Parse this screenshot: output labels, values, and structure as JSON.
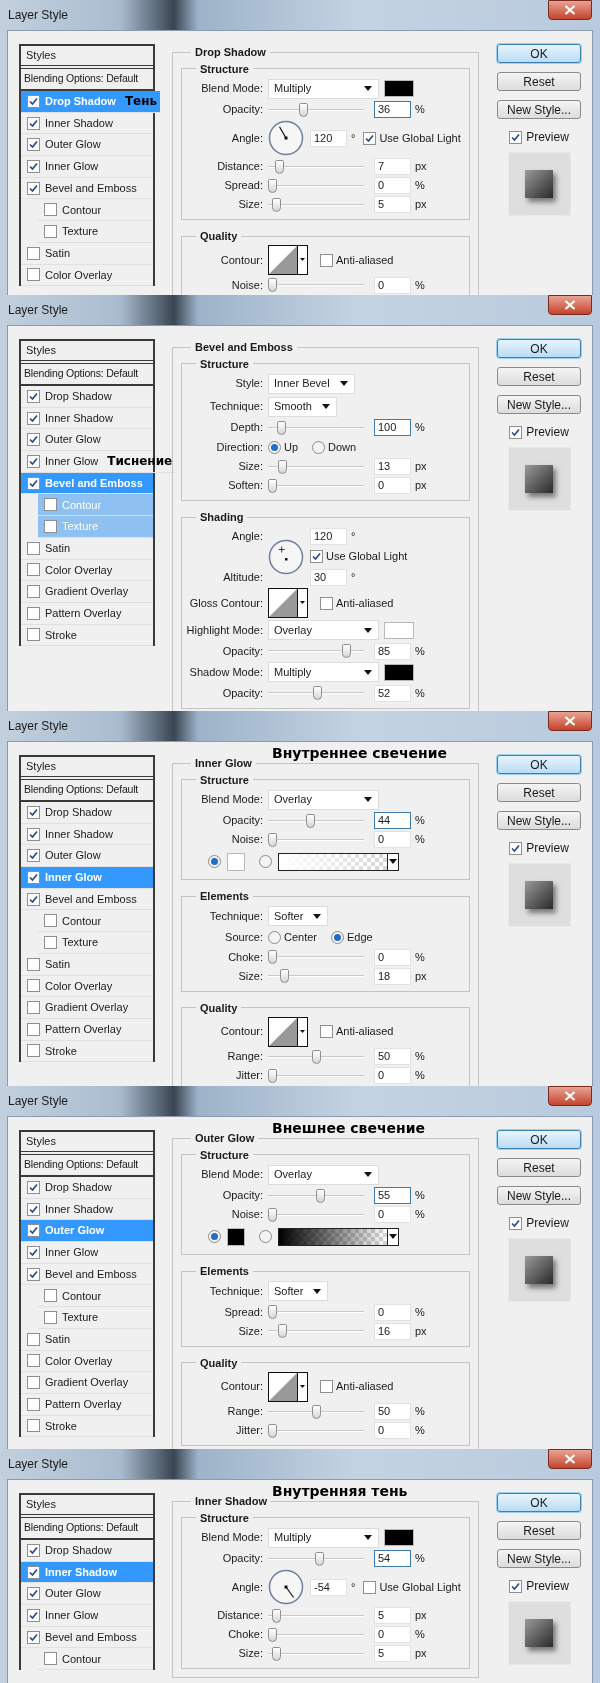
{
  "dialogs": [
    {
      "title": "Layer Style",
      "styles_list": {
        "header": "Styles",
        "blending": {
          "label": "Blending Options: Default",
          "selected": false
        },
        "items": [
          {
            "label": "Drop Shadow",
            "checked": true,
            "selected": true,
            "annotation": "Тень"
          },
          {
            "label": "Inner Shadow",
            "checked": true,
            "selected": false
          },
          {
            "label": "Outer Glow",
            "checked": true,
            "selected": false
          },
          {
            "label": "Inner Glow",
            "checked": true,
            "selected": false
          },
          {
            "label": "Bevel and Emboss",
            "checked": true,
            "selected": false,
            "children": [
              {
                "label": "Contour",
                "checked": false,
                "selected": false
              },
              {
                "label": "Texture",
                "checked": false,
                "selected": false
              }
            ]
          },
          {
            "label": "Satin",
            "checked": false,
            "selected": false
          },
          {
            "label": "Color Overlay",
            "checked": false,
            "selected": false
          }
        ]
      },
      "panel": {
        "title": "Drop Shadow",
        "groups": [
          {
            "title": "Structure",
            "rows": [
              {
                "kind": "mode_dropdown",
                "label": "Blend Mode:",
                "value": "Multiply",
                "color": "#000000"
              },
              {
                "kind": "slider",
                "label": "Opacity:",
                "level": 0.36,
                "value": "36",
                "unit": "%",
                "focused": true
              },
              {
                "kind": "angle",
                "label": "Angle:",
                "value": "120",
                "unit": "°",
                "option": "Use Global Light",
                "checked": true
              },
              {
                "kind": "slider",
                "label": "Distance:",
                "level": 0.08,
                "value": "7",
                "unit": "px",
                "focused": false
              },
              {
                "kind": "slider",
                "label": "Spread:",
                "level": 0,
                "value": "0",
                "unit": "%",
                "focused": false
              },
              {
                "kind": "slider",
                "label": "Size:",
                "level": 0.05,
                "value": "5",
                "unit": "px",
                "focused": false
              }
            ]
          },
          {
            "title": "Quality",
            "rows": [
              {
                "kind": "contour",
                "label": "Contour:",
                "option": "Anti-aliased",
                "checked": false
              },
              {
                "kind": "slider",
                "label": "Noise:",
                "level": 0,
                "value": "0",
                "unit": "%",
                "focused": false
              }
            ]
          }
        ]
      },
      "buttons": [
        "OK",
        "Reset",
        "New Style..."
      ],
      "preview": {
        "label": "Preview",
        "checked": true
      }
    },
    {
      "title": "Layer Style",
      "styles_list": {
        "header": "Styles",
        "blending": {
          "label": "Blending Options: Default",
          "selected": false
        },
        "items": [
          {
            "label": "Drop Shadow",
            "checked": true,
            "selected": false
          },
          {
            "label": "Inner Shadow",
            "checked": true,
            "selected": false
          },
          {
            "label": "Outer Glow",
            "checked": true,
            "selected": false
          },
          {
            "label": "Inner Glow",
            "checked": true,
            "selected": false,
            "annotation": "Тиснение"
          },
          {
            "label": "Bevel and Emboss",
            "checked": true,
            "selected": true,
            "children": [
              {
                "label": "Contour",
                "checked": false,
                "selected": false
              },
              {
                "label": "Texture",
                "checked": false,
                "selected": false
              }
            ]
          },
          {
            "label": "Satin",
            "checked": false,
            "selected": false
          },
          {
            "label": "Color Overlay",
            "checked": false,
            "selected": false
          },
          {
            "label": "Gradient Overlay",
            "checked": false,
            "selected": false
          },
          {
            "label": "Pattern Overlay",
            "checked": false,
            "selected": false
          },
          {
            "label": "Stroke",
            "checked": false,
            "selected": false
          }
        ]
      },
      "panel": {
        "title": "Bevel and Emboss",
        "groups": [
          {
            "title": "Structure",
            "rows": [
              {
                "kind": "dropdown",
                "label": "Style:",
                "value": "Inner Bevel"
              },
              {
                "kind": "dropdown",
                "label": "Technique:",
                "value": "Smooth"
              },
              {
                "kind": "slider",
                "label": "Depth:",
                "level": 0.1,
                "value": "100",
                "unit": "%",
                "focused": true
              },
              {
                "kind": "radio",
                "label": "Direction:",
                "options": [
                  {
                    "label": "Up",
                    "selected": true
                  },
                  {
                    "label": "Down",
                    "selected": false
                  }
                ]
              },
              {
                "kind": "slider",
                "label": "Size:",
                "level": 0.12,
                "value": "13",
                "unit": "px",
                "focused": false
              },
              {
                "kind": "slider",
                "label": "Soften:",
                "level": 0,
                "value": "0",
                "unit": "px",
                "focused": false
              }
            ]
          },
          {
            "title": "Shading",
            "rows": [
              {
                "kind": "shading",
                "label": "Angle:",
                "value": "120",
                "unit": "°",
                "option": "Use Global Light",
                "checked": true,
                "altitude_label": "Altitude:",
                "altitude_value": "30",
                "altitude_unit": "°"
              },
              {
                "kind": "contour",
                "label": "Gloss Contour:",
                "option": "Anti-aliased",
                "checked": false
              },
              {
                "kind": "mode_dropdown",
                "label": "Highlight Mode:",
                "value": "Overlay",
                "color": "#ffffff"
              },
              {
                "kind": "slider",
                "label": "Opacity:",
                "level": 0.85,
                "value": "85",
                "unit": "%",
                "focused": false
              },
              {
                "kind": "mode_dropdown",
                "label": "Shadow Mode:",
                "value": "Multiply",
                "color": "#000000"
              },
              {
                "kind": "slider",
                "label": "Opacity:",
                "level": 0.52,
                "value": "52",
                "unit": "%",
                "focused": false
              }
            ]
          }
        ]
      },
      "buttons": [
        "OK",
        "Reset",
        "New Style..."
      ],
      "preview": {
        "label": "Preview",
        "checked": true
      }
    },
    {
      "title": "Layer Style",
      "styles_list": {
        "header": "Styles",
        "blending": {
          "label": "Blending Options: Default",
          "selected": false
        },
        "items": [
          {
            "label": "Drop Shadow",
            "checked": true,
            "selected": false
          },
          {
            "label": "Inner Shadow",
            "checked": true,
            "selected": false
          },
          {
            "label": "Outer Glow",
            "checked": true,
            "selected": false
          },
          {
            "label": "Inner Glow",
            "checked": true,
            "selected": true
          },
          {
            "label": "Bevel and Emboss",
            "checked": true,
            "selected": false,
            "children": [
              {
                "label": "Contour",
                "checked": false,
                "selected": false
              },
              {
                "label": "Texture",
                "checked": false,
                "selected": false
              }
            ]
          },
          {
            "label": "Satin",
            "checked": false,
            "selected": false
          },
          {
            "label": "Color Overlay",
            "checked": false,
            "selected": false
          },
          {
            "label": "Gradient Overlay",
            "checked": false,
            "selected": false
          },
          {
            "label": "Pattern Overlay",
            "checked": false,
            "selected": false
          },
          {
            "label": "Stroke",
            "checked": false,
            "selected": false
          }
        ]
      },
      "panel": {
        "annotation": "Внутреннее свечение",
        "title": "Inner Glow",
        "groups": [
          {
            "title": "Structure",
            "rows": [
              {
                "kind": "mode_dropdown",
                "label": "Blend Mode:",
                "value": "Overlay"
              },
              {
                "kind": "slider",
                "label": "Opacity:",
                "level": 0.44,
                "value": "44",
                "unit": "%",
                "focused": true
              },
              {
                "kind": "slider",
                "label": "Noise:",
                "level": 0,
                "value": "0",
                "unit": "%",
                "focused": false
              },
              {
                "kind": "fill",
                "choices": [
                  {
                    "kind": "color",
                    "selected": true,
                    "color": "#ffffff"
                  },
                  {
                    "kind": "gradient",
                    "selected": false
                  }
                ]
              }
            ]
          },
          {
            "title": "Elements",
            "rows": [
              {
                "kind": "dropdown",
                "label": "Technique:",
                "value": "Softer"
              },
              {
                "kind": "radio",
                "label": "Source:",
                "options": [
                  {
                    "label": "Center",
                    "selected": false
                  },
                  {
                    "label": "Edge",
                    "selected": true
                  }
                ]
              },
              {
                "kind": "slider",
                "label": "Choke:",
                "level": 0,
                "value": "0",
                "unit": "%",
                "focused": false
              },
              {
                "kind": "slider",
                "label": "Size:",
                "level": 0.14,
                "value": "18",
                "unit": "px",
                "focused": false
              }
            ]
          },
          {
            "title": "Quality",
            "rows": [
              {
                "kind": "contour",
                "label": "Contour:",
                "option": "Anti-aliased",
                "checked": false
              },
              {
                "kind": "slider",
                "label": "Range:",
                "level": 0.5,
                "value": "50",
                "unit": "%",
                "focused": false
              },
              {
                "kind": "slider",
                "label": "Jitter:",
                "level": 0,
                "value": "0",
                "unit": "%",
                "focused": false
              }
            ]
          }
        ]
      },
      "buttons": [
        "OK",
        "Reset",
        "New Style..."
      ],
      "preview": {
        "label": "Preview",
        "checked": true
      }
    },
    {
      "title": "Layer Style",
      "styles_list": {
        "header": "Styles",
        "blending": {
          "label": "Blending Options: Default",
          "selected": false
        },
        "items": [
          {
            "label": "Drop Shadow",
            "checked": true,
            "selected": false
          },
          {
            "label": "Inner Shadow",
            "checked": true,
            "selected": false
          },
          {
            "label": "Outer Glow",
            "checked": true,
            "selected": true
          },
          {
            "label": "Inner Glow",
            "checked": true,
            "selected": false
          },
          {
            "label": "Bevel and Emboss",
            "checked": true,
            "selected": false,
            "children": [
              {
                "label": "Contour",
                "checked": false,
                "selected": false
              },
              {
                "label": "Texture",
                "checked": false,
                "selected": false
              }
            ]
          },
          {
            "label": "Satin",
            "checked": false,
            "selected": false
          },
          {
            "label": "Color Overlay",
            "checked": false,
            "selected": false
          },
          {
            "label": "Gradient Overlay",
            "checked": false,
            "selected": false
          },
          {
            "label": "Pattern Overlay",
            "checked": false,
            "selected": false
          },
          {
            "label": "Stroke",
            "checked": false,
            "selected": false
          }
        ]
      },
      "panel": {
        "annotation": "Внешнее свечение",
        "title": "Outer Glow",
        "groups": [
          {
            "title": "Structure",
            "rows": [
              {
                "kind": "mode_dropdown",
                "label": "Blend Mode:",
                "value": "Overlay"
              },
              {
                "kind": "slider",
                "label": "Opacity:",
                "level": 0.55,
                "value": "55",
                "unit": "%",
                "focused": true
              },
              {
                "kind": "slider",
                "label": "Noise:",
                "level": 0,
                "value": "0",
                "unit": "%",
                "focused": false
              },
              {
                "kind": "fill",
                "choices": [
                  {
                    "kind": "color",
                    "selected": true,
                    "color": "#000000"
                  },
                  {
                    "kind": "gradient",
                    "selected": false
                  }
                ]
              }
            ]
          },
          {
            "title": "Elements",
            "rows": [
              {
                "kind": "dropdown",
                "label": "Technique:",
                "value": "Softer"
              },
              {
                "kind": "slider",
                "label": "Spread:",
                "level": 0,
                "value": "0",
                "unit": "%",
                "focused": false
              },
              {
                "kind": "slider",
                "label": "Size:",
                "level": 0.12,
                "value": "16",
                "unit": "px",
                "focused": false
              }
            ]
          },
          {
            "title": "Quality",
            "rows": [
              {
                "kind": "contour",
                "label": "Contour:",
                "option": "Anti-aliased",
                "checked": false
              },
              {
                "kind": "slider",
                "label": "Range:",
                "level": 0.5,
                "value": "50",
                "unit": "%",
                "focused": false
              },
              {
                "kind": "slider",
                "label": "Jitter:",
                "level": 0,
                "value": "0",
                "unit": "%",
                "focused": false
              }
            ]
          }
        ]
      },
      "buttons": [
        "OK",
        "Reset",
        "New Style..."
      ],
      "preview": {
        "label": "Preview",
        "checked": true
      }
    },
    {
      "title": "Layer Style",
      "styles_list": {
        "header": "Styles",
        "blending": {
          "label": "Blending Options: Default",
          "selected": false
        },
        "items": [
          {
            "label": "Drop Shadow",
            "checked": true,
            "selected": false
          },
          {
            "label": "Inner Shadow",
            "checked": true,
            "selected": true
          },
          {
            "label": "Outer Glow",
            "checked": true,
            "selected": false
          },
          {
            "label": "Inner Glow",
            "checked": true,
            "selected": false
          },
          {
            "label": "Bevel and Emboss",
            "checked": true,
            "selected": false,
            "children": [
              {
                "label": "Contour",
                "checked": false,
                "selected": false
              }
            ]
          }
        ]
      },
      "panel": {
        "annotation": "Внутренняя тень",
        "title": "Inner Shadow",
        "groups": [
          {
            "title": "Structure",
            "rows": [
              {
                "kind": "mode_dropdown",
                "label": "Blend Mode:",
                "value": "Multiply",
                "color": "#000000"
              },
              {
                "kind": "slider",
                "label": "Opacity:",
                "level": 0.54,
                "value": "54",
                "unit": "%",
                "focused": true
              },
              {
                "kind": "angle",
                "label": "Angle:",
                "value": "-54",
                "unit": "°",
                "option": "Use Global Light",
                "checked": false
              },
              {
                "kind": "slider",
                "label": "Distance:",
                "level": 0.05,
                "value": "5",
                "unit": "px",
                "focused": false
              },
              {
                "kind": "slider",
                "label": "Choke:",
                "level": 0,
                "value": "0",
                "unit": "%",
                "focused": false
              },
              {
                "kind": "slider",
                "label": "Size:",
                "level": 0.05,
                "value": "5",
                "unit": "px",
                "focused": false
              }
            ]
          }
        ]
      },
      "buttons": [
        "OK",
        "Reset",
        "New Style..."
      ],
      "preview": {
        "label": "Preview",
        "checked": true
      }
    }
  ]
}
